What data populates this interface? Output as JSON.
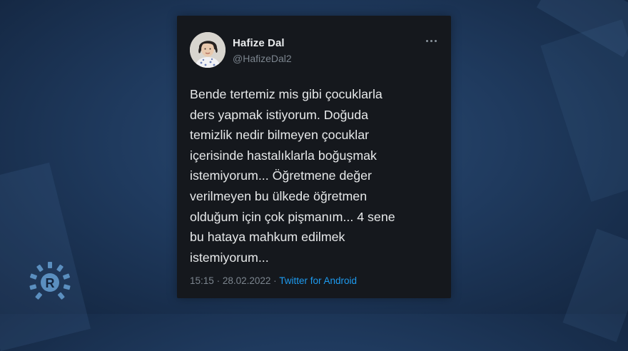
{
  "tweet": {
    "author_name": "Hafize Dal",
    "author_handle": "@HafizeDal2",
    "text": "Bende tertemiz mis gibi çocuklarla\nders yapmak istiyorum. Doğuda\ntemizlik nedir bilmeyen çocuklar\niçerisinde hastalıklarla boğuşmak\nistemiyorum... Öğretmene değer\nverilmeyen bu ülkede öğretmen\nolduğum için çok pişmanım... 4 sene\nbu hataya mahkum edilmek\nistemiyorum...",
    "time": "15:15",
    "date": "28.02.2022",
    "separator": "·",
    "source": "Twitter for Android",
    "more_icon": "more-options-icon"
  },
  "background": {
    "logo_letter": "R",
    "accent_color": "#1d9bf0",
    "card_color": "#15181d",
    "bg_color": "#1f3a5e"
  }
}
